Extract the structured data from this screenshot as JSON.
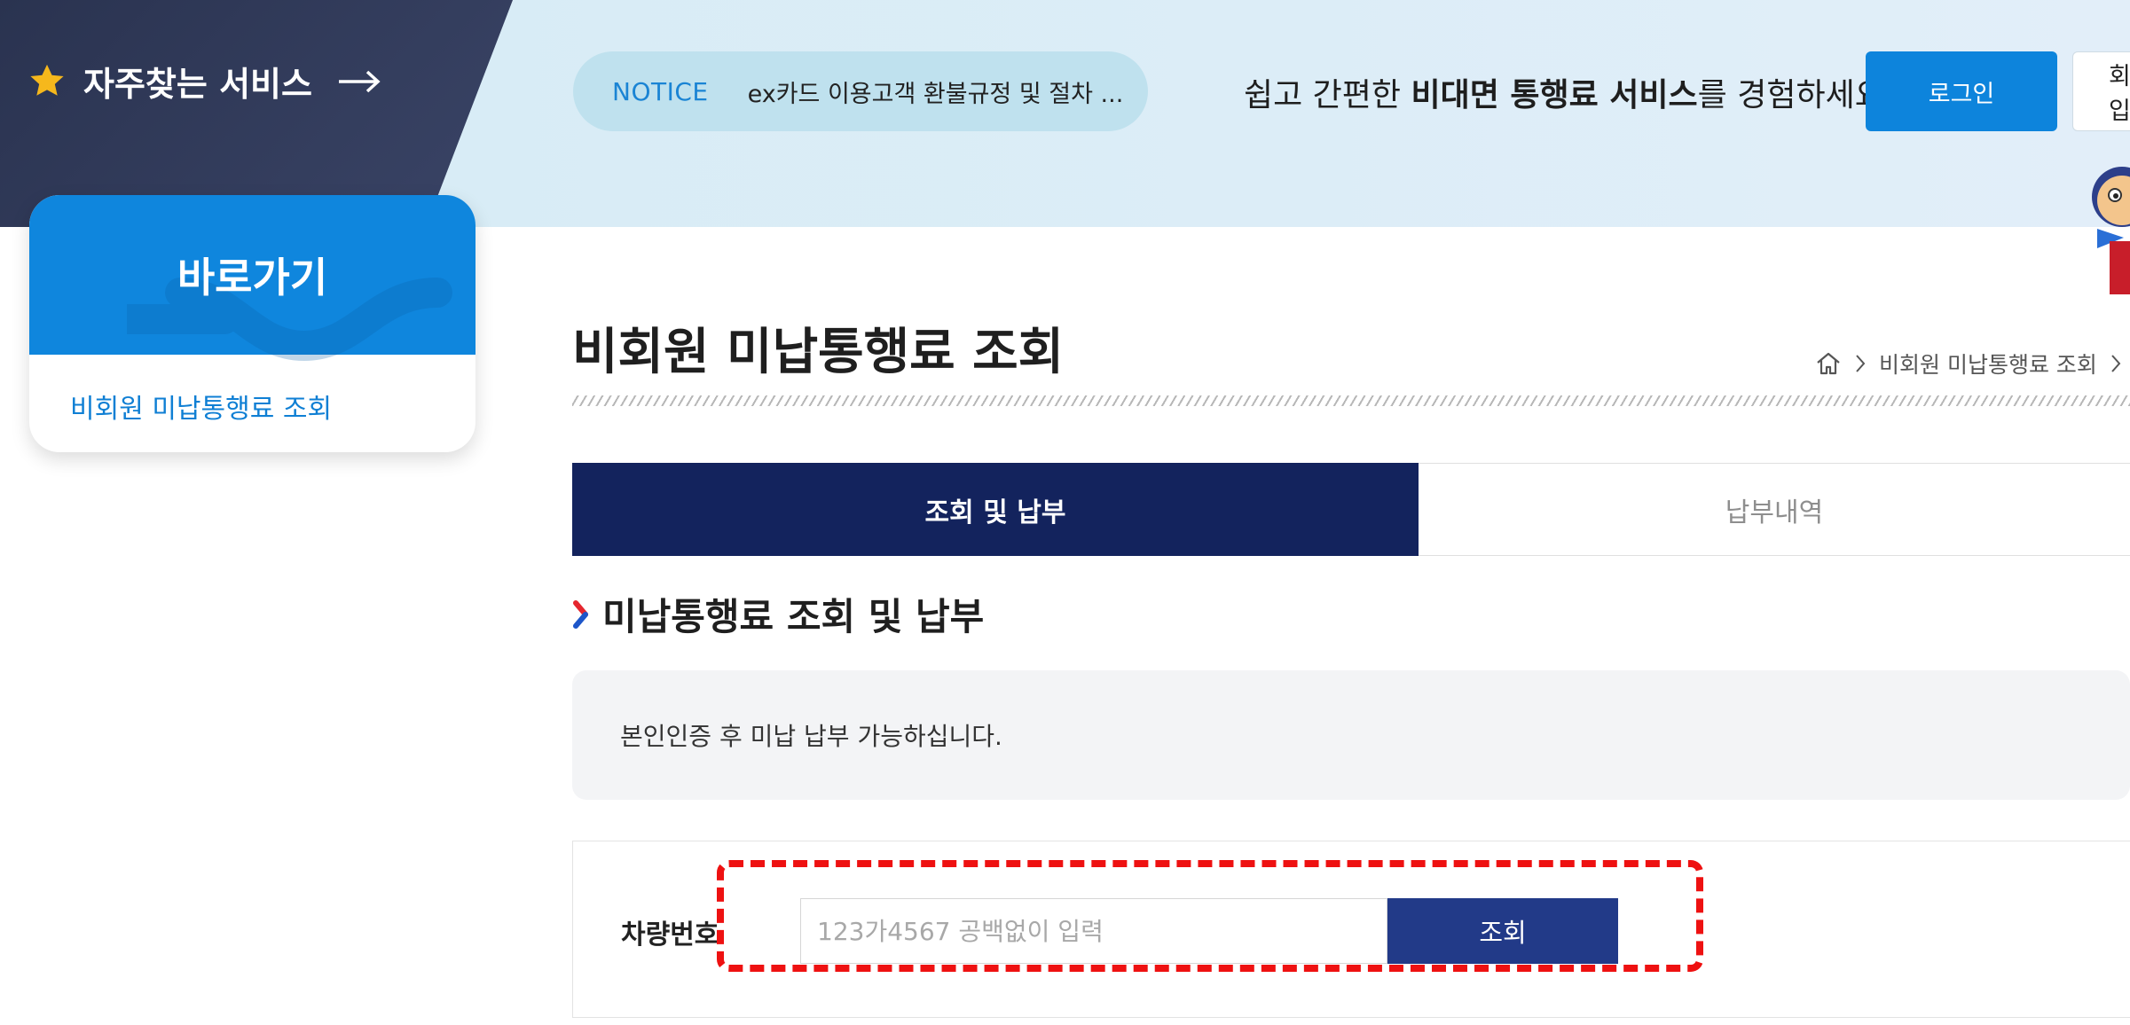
{
  "header": {
    "favorites_label": "자주찾는 서비스",
    "notice": {
      "label": "NOTICE",
      "text": "ex카드 이용고객 환불규정 및 절차 ..."
    },
    "promo": {
      "prefix": "쉽고 간편한 ",
      "bold": "비대면 통행료 서비스",
      "suffix": "를 경험하세요"
    },
    "login_label": "로그인",
    "join_label": "회원가입"
  },
  "sidebar": {
    "title": "바로가기",
    "items": [
      {
        "label": "비회원 미납통행료 조회"
      }
    ]
  },
  "page": {
    "title": "비회원 미납통행료 조회",
    "breadcrumb": [
      "비회원 미납통행료 조회"
    ]
  },
  "tabs": [
    {
      "label": "조회 및 납부",
      "active": true
    },
    {
      "label": "납부내역",
      "active": false
    }
  ],
  "section": {
    "title": "미납통행료 조회 및 납부",
    "info": "본인인증 후 미납 납부 가능하십니다."
  },
  "form": {
    "vehicle_label": "차량번호",
    "vehicle_placeholder": "123가4567 공백없이 입력",
    "vehicle_value": "",
    "search_label": "조회"
  },
  "colors": {
    "brand_blue": "#0f86dd",
    "navy": "#13235d",
    "button_navy": "#223a88",
    "highlight_red": "#ee1111"
  },
  "icons": [
    "star-icon",
    "arrow-right-icon",
    "home-icon",
    "chevron-right-icon",
    "section-chevron-icon"
  ]
}
